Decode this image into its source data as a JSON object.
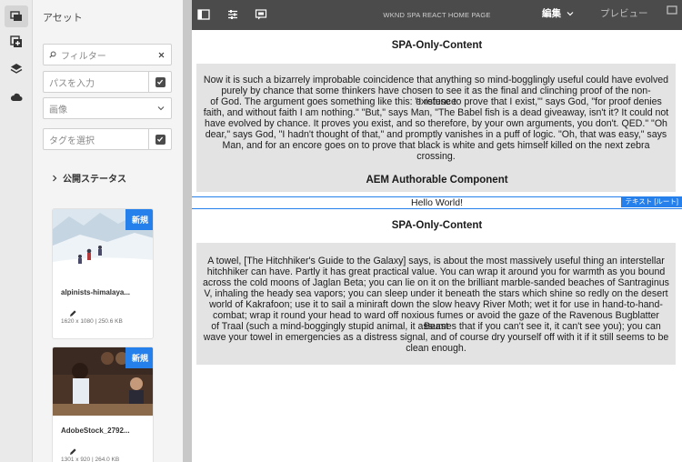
{
  "rail": {
    "items": [
      {
        "icon": "assets-icon",
        "active": true
      },
      {
        "icon": "add-component-icon",
        "active": false
      },
      {
        "icon": "layers-icon",
        "active": false
      },
      {
        "icon": "cloud-icon",
        "active": false
      }
    ]
  },
  "panel": {
    "title": "アセット",
    "filter_placeholder": "フィルター",
    "path_placeholder": "パスを入力",
    "type_value": "画像",
    "tag_placeholder": "タグを選択",
    "publish_status_label": "公開ステータス",
    "assets": [
      {
        "name": "alpinists-himalaya...",
        "meta": "1620 x 1080 | 250.6 KB",
        "badge": "新規"
      },
      {
        "name": "AdobeStock_2792...",
        "meta": "1301 x 920 | 264.0 KB",
        "badge": "新規"
      }
    ]
  },
  "topbar": {
    "page_title": "WKND SPA REACT HOME PAGE",
    "edit_label": "編集",
    "preview_label": "プレビュー"
  },
  "content": {
    "heading1": "SPA-Only-Content",
    "text1": [
      "Now it is such a bizarrely improbable coincidence that anything so mind-bogglingly useful could have evolved",
      "purely by chance that some thinkers have chosen to see it as the final and clinching proof of the non-existence",
      "of God. The argument goes something like this: \"I refuse to prove that I exist,'\" says God, \"for proof denies",
      "faith, and without faith I am nothing.\" \"But,\" says Man, \"The Babel fish is a dead giveaway, isn't it? It could not",
      "have evolved by chance. It proves you exist, and so therefore, by your own arguments, you don't. QED.\" \"Oh",
      "dear,\" says God, \"I hadn't thought of that,\" and promptly vanishes in a puff of logic. \"Oh, that was easy,\" says",
      "Man, and for an encore goes on to prove that black is white and gets himself killed on the next zebra crossing."
    ],
    "heading2": "AEM Authorable Component",
    "hello": "Hello World!",
    "hello_tag": "テキスト [ルート]",
    "heading3": "SPA-Only-Content",
    "text2": [
      "A towel, [The Hitchhiker's Guide to the Galaxy] says, is about the most massively useful thing an interstellar",
      "hitchhiker can have. Partly it has great practical value. You can wrap it around you for warmth as you bound",
      "across the cold moons of Jaglan Beta; you can lie on it on the brilliant marble-sanded beaches of Santraginus",
      "V, inhaling the heady sea vapors; you can sleep under it beneath the stars which shine so redly on the desert",
      "world of Kakrafoon; use it to sail a miniraft down the slow heavy River Moth; wet it for use in hand-to-hand-",
      "combat; wrap it round your head to ward off noxious fumes or avoid the gaze of the Ravenous Bugblatter Beast",
      "of Traal (such a mind-boggingly stupid animal, it assumes that if you can't see it, it can't see you); you can",
      "wave your towel in emergencies as a distress signal, and of course dry yourself off with it if it still seems to be",
      "clean enough."
    ]
  },
  "colors": {
    "accent": "#2680eb",
    "topbar": "#4b4b4b",
    "textbox": "#e3e3e3"
  }
}
